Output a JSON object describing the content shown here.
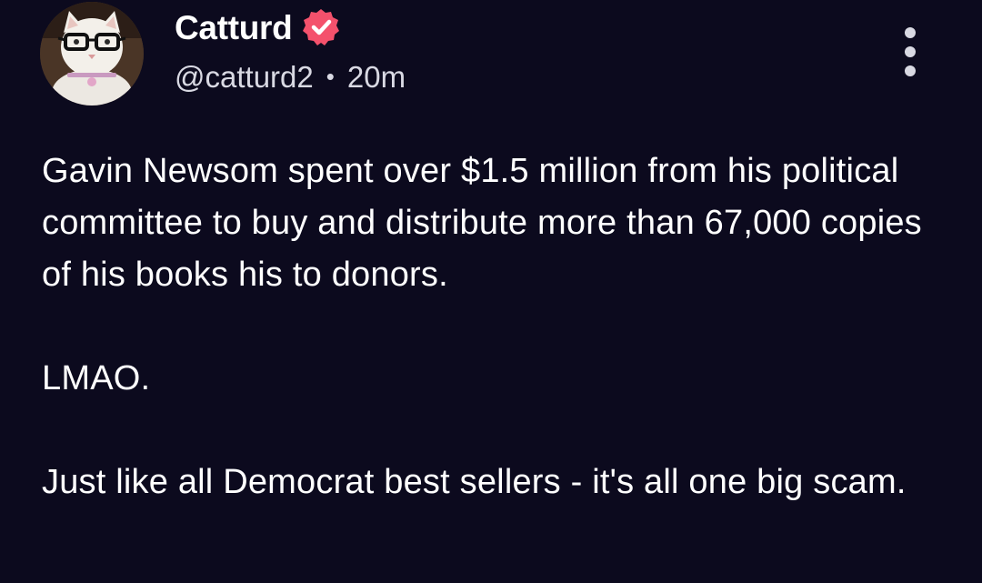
{
  "post": {
    "author": {
      "display_name": "Catturd",
      "handle": "@catturd2",
      "verified": true,
      "verified_color": "#f4516c"
    },
    "separator": "•",
    "time": "20m",
    "more_icon": "more-vertical-icon",
    "paragraphs": [
      "Gavin Newsom spent over $1.5 million from his political committee to buy and distribute more than 67,000 copies of his books his to donors.",
      "LMAO.",
      "Just like all Democrat best sellers - it's all one big scam."
    ]
  },
  "colors": {
    "background": "#0c0a1e",
    "text": "#ffffff",
    "meta_text": "#d9d9e3"
  }
}
